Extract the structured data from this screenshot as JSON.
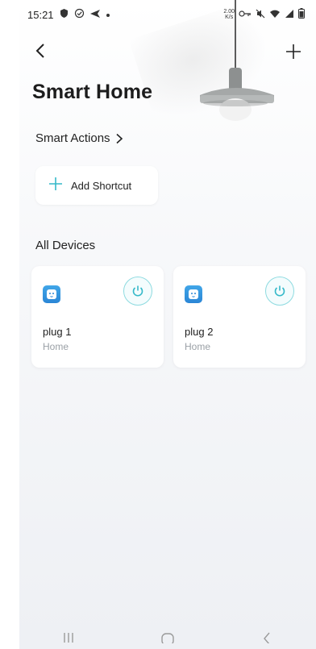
{
  "status_bar": {
    "time": "15:21",
    "left_icons": [
      "shield-icon",
      "check-circle-icon",
      "send-icon",
      "dot-icon"
    ],
    "right_icons": [
      "data-speed-icon",
      "key-icon",
      "mute-icon",
      "wifi-icon",
      "signal-icon",
      "battery-icon"
    ],
    "data_speed": "2.00\nK/s"
  },
  "header": {
    "title": "Smart Home"
  },
  "smart_actions": {
    "label": "Smart Actions",
    "chevron": ">"
  },
  "shortcut": {
    "label": "Add Shortcut"
  },
  "devices_section": {
    "title": "All Devices",
    "devices": [
      {
        "name": "plug 1",
        "room": "Home"
      },
      {
        "name": "plug 2",
        "room": "Home"
      }
    ]
  },
  "colors": {
    "accent": "#35b9c9",
    "plug_blue": "#2b86d6",
    "power_ring": "#8edbe0"
  },
  "nav_bar": {
    "icons": [
      "recent-apps-icon",
      "home-icon",
      "back-nav-icon"
    ]
  }
}
